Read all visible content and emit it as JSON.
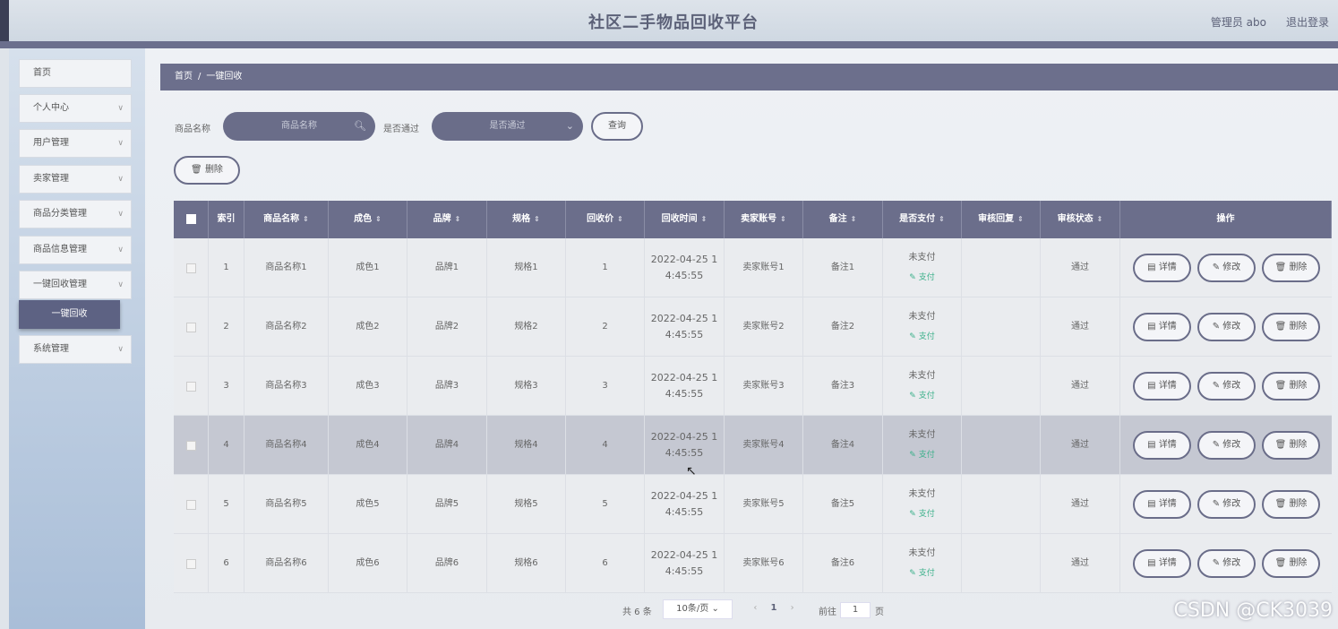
{
  "header": {
    "title": "社区二手物品回收平台",
    "admin": "管理员 abo",
    "logout": "退出登录"
  },
  "sidebar": {
    "items": [
      {
        "label": "首页",
        "chevron": false
      },
      {
        "label": "个人中心",
        "chevron": true
      },
      {
        "label": "用户管理",
        "chevron": true
      },
      {
        "label": "卖家管理",
        "chevron": true
      },
      {
        "label": "商品分类管理",
        "chevron": true
      },
      {
        "label": "商品信息管理",
        "chevron": true
      },
      {
        "label": "一键回收管理",
        "chevron": true
      },
      {
        "label": "系统管理",
        "chevron": true
      }
    ],
    "submenu_active": "一键回收"
  },
  "breadcrumb": {
    "home": "首页",
    "sep": "/",
    "current": "一键回收"
  },
  "search": {
    "name_label": "商品名称",
    "name_placeholder": "商品名称",
    "pass_label": "是否通过",
    "pass_placeholder": "是否通过",
    "query_button": "查询",
    "delete_button": "删除"
  },
  "table": {
    "headers": [
      "索引",
      "商品名称",
      "成色",
      "品牌",
      "规格",
      "回收价",
      "回收时间",
      "卖家账号",
      "备注",
      "是否支付",
      "审核回复",
      "审核状态",
      "操作"
    ],
    "rows": [
      {
        "index": "1",
        "name": "商品名称1",
        "condition": "成色1",
        "brand": "品牌1",
        "spec": "规格1",
        "price": "1",
        "time1": "2022-04-25 1",
        "time2": "4:45:55",
        "seller": "卖家账号1",
        "note": "备注1",
        "pay": "未支付",
        "pay_link": "支付",
        "reply": "",
        "status": "通过"
      },
      {
        "index": "2",
        "name": "商品名称2",
        "condition": "成色2",
        "brand": "品牌2",
        "spec": "规格2",
        "price": "2",
        "time1": "2022-04-25 1",
        "time2": "4:45:55",
        "seller": "卖家账号2",
        "note": "备注2",
        "pay": "未支付",
        "pay_link": "支付",
        "reply": "",
        "status": "通过"
      },
      {
        "index": "3",
        "name": "商品名称3",
        "condition": "成色3",
        "brand": "品牌3",
        "spec": "规格3",
        "price": "3",
        "time1": "2022-04-25 1",
        "time2": "4:45:55",
        "seller": "卖家账号3",
        "note": "备注3",
        "pay": "未支付",
        "pay_link": "支付",
        "reply": "",
        "status": "通过"
      },
      {
        "index": "4",
        "name": "商品名称4",
        "condition": "成色4",
        "brand": "品牌4",
        "spec": "规格4",
        "price": "4",
        "time1": "2022-04-25 1",
        "time2": "4:45:55",
        "seller": "卖家账号4",
        "note": "备注4",
        "pay": "未支付",
        "pay_link": "支付",
        "reply": "",
        "status": "通过"
      },
      {
        "index": "5",
        "name": "商品名称5",
        "condition": "成色5",
        "brand": "品牌5",
        "spec": "规格5",
        "price": "5",
        "time1": "2022-04-25 1",
        "time2": "4:45:55",
        "seller": "卖家账号5",
        "note": "备注5",
        "pay": "未支付",
        "pay_link": "支付",
        "reply": "",
        "status": "通过"
      },
      {
        "index": "6",
        "name": "商品名称6",
        "condition": "成色6",
        "brand": "品牌6",
        "spec": "规格6",
        "price": "6",
        "time1": "2022-04-25 1",
        "time2": "4:45:55",
        "seller": "卖家账号6",
        "note": "备注6",
        "pay": "未支付",
        "pay_link": "支付",
        "reply": "",
        "status": "通过"
      }
    ],
    "highlighted_row": 4,
    "actions": {
      "detail": "详情",
      "edit": "修改",
      "delete": "删除"
    }
  },
  "pagination": {
    "total": "共 6 条",
    "page_size": "10条/页",
    "current": "1",
    "goto_prefix": "前往",
    "goto_value": "1",
    "goto_suffix": "页"
  },
  "watermark": "CSDN @CK3039"
}
